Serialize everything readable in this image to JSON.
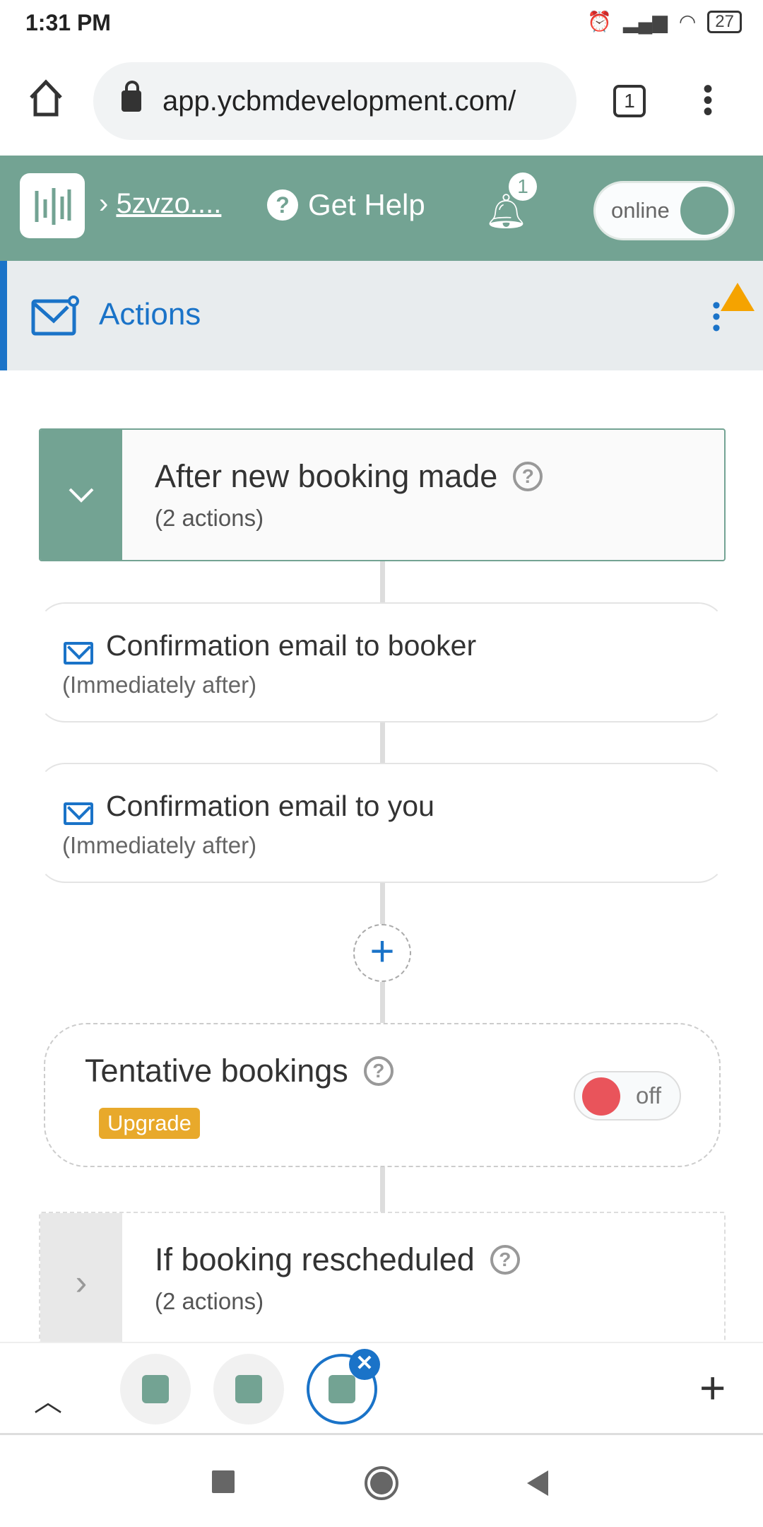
{
  "status_bar": {
    "time": "1:31 PM",
    "battery": "27",
    "icons": [
      "alarm-icon",
      "signal-icon",
      "wifi-icon",
      "battery-icon"
    ]
  },
  "browser": {
    "url": "app.ycbmdevelopment.com/",
    "tab_count": "1"
  },
  "header": {
    "breadcrumb": "5zvzo....",
    "help_label": "Get Help",
    "notification_count": "1",
    "status_toggle": "online",
    "brand_color": "#73a393"
  },
  "section": {
    "title": "Actions",
    "accent": "#1a73c8"
  },
  "triggers": [
    {
      "title": "After new booking made",
      "subtitle": "(2 actions)",
      "expanded": true,
      "actions": [
        {
          "title": "Confirmation email to booker",
          "timing": "(Immediately after)"
        },
        {
          "title": "Confirmation email to you",
          "timing": "(Immediately after)"
        }
      ]
    },
    {
      "title": "If booking rescheduled",
      "subtitle": "(2 actions)",
      "expanded": false
    }
  ],
  "tentative": {
    "title": "Tentative bookings",
    "badge": "Upgrade",
    "toggle": "off"
  },
  "tab_switcher": {
    "tabs": 3,
    "selected": 3
  }
}
